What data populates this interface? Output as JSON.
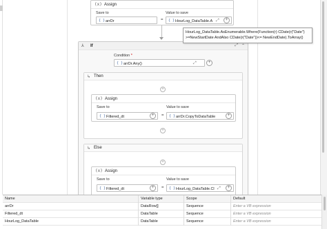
{
  "top_assign": {
    "title": "Assign",
    "save_to_label": "Save to",
    "value_label": "Value to save",
    "save_to_value": "arrDr",
    "value_value": "HourLog_DataTable.A"
  },
  "tooltip": {
    "line1": "HourLog_DataTable.AsEnumerable.Where(Function(r) CDate(r(\"Date\")",
    "line2": ">=NewStartDate AndAlso CDate(r(\"Date\"))<= NewEndDate).ToArray()"
  },
  "if_activity": {
    "title": "If",
    "condition_label": "Condition",
    "required_mark": "*",
    "condition_value": "arrDr.Any()"
  },
  "then_section": {
    "title": "Then",
    "assign": {
      "title": "Assign",
      "save_to_label": "Save to",
      "value_label": "Value to save",
      "save_to_value": "Filtered_dt",
      "value_value": "arrDr.CopyToDataTable"
    }
  },
  "else_section": {
    "title": "Else",
    "assign": {
      "title": "Assign",
      "save_to_label": "Save to",
      "value_label": "Value to save",
      "save_to_value": "Filtered_dt",
      "value_value": "HourLog_DataTable.Cl"
    }
  },
  "icons": {
    "assign": "(x)",
    "expression": "{ }",
    "equals": "=",
    "plus": "+",
    "expand": "⤢",
    "collapse": "⌃",
    "if": "⅄",
    "then": "↳",
    "else": "↳"
  },
  "variables": {
    "headers": [
      "Name",
      "Variable type",
      "Scope",
      "Default"
    ],
    "rows": [
      [
        "arrDr",
        "DataRow[]",
        "Sequence",
        "Enter a VB expression"
      ],
      [
        "Filtered_dt",
        "DataTable",
        "Sequence",
        "Enter a VB expression"
      ],
      [
        "HourLog_DataTable",
        "DataTable",
        "Sequence",
        "Enter a VB expression"
      ]
    ]
  },
  "colors": {
    "border": "#c9c9c9",
    "accent": "#4a6fa5",
    "placeholder": "#8a8a8a"
  }
}
